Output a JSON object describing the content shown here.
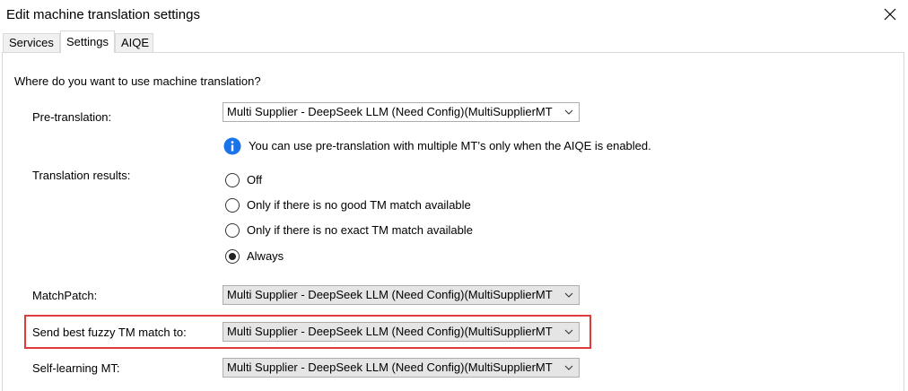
{
  "window": {
    "title": "Edit machine translation settings"
  },
  "tabs": [
    {
      "label": "Services"
    },
    {
      "label": "Settings"
    },
    {
      "label": "AIQE"
    }
  ],
  "settings": {
    "question": "Where do you want to use machine translation?",
    "pretranslation": {
      "label": "Pre-translation:",
      "value": "Multi Supplier - DeepSeek LLM (Need Config)(MultiSupplierMT",
      "info": "You can use pre-translation with multiple MT’s only when the AIQE is enabled."
    },
    "translation_results": {
      "label": "Translation results:",
      "options": [
        {
          "label": "Off",
          "selected": false
        },
        {
          "label": "Only if there is no good TM match available",
          "selected": false
        },
        {
          "label": "Only if there is no exact TM match available",
          "selected": false
        },
        {
          "label": "Always",
          "selected": true
        }
      ]
    },
    "matchpatch": {
      "label": "MatchPatch:",
      "value": "Multi Supplier - DeepSeek LLM (Need Config)(MultiSupplierMT"
    },
    "best_fuzzy": {
      "label": "Send best fuzzy TM match to:",
      "value": "Multi Supplier - DeepSeek LLM (Need Config)(MultiSupplierMT"
    },
    "self_learning": {
      "label": "Self-learning MT:",
      "value": "Multi Supplier - DeepSeek LLM (Need Config)(MultiSupplierMT"
    }
  },
  "colors": {
    "highlight": "#e03a3a",
    "info_icon": "#1a73e8"
  }
}
